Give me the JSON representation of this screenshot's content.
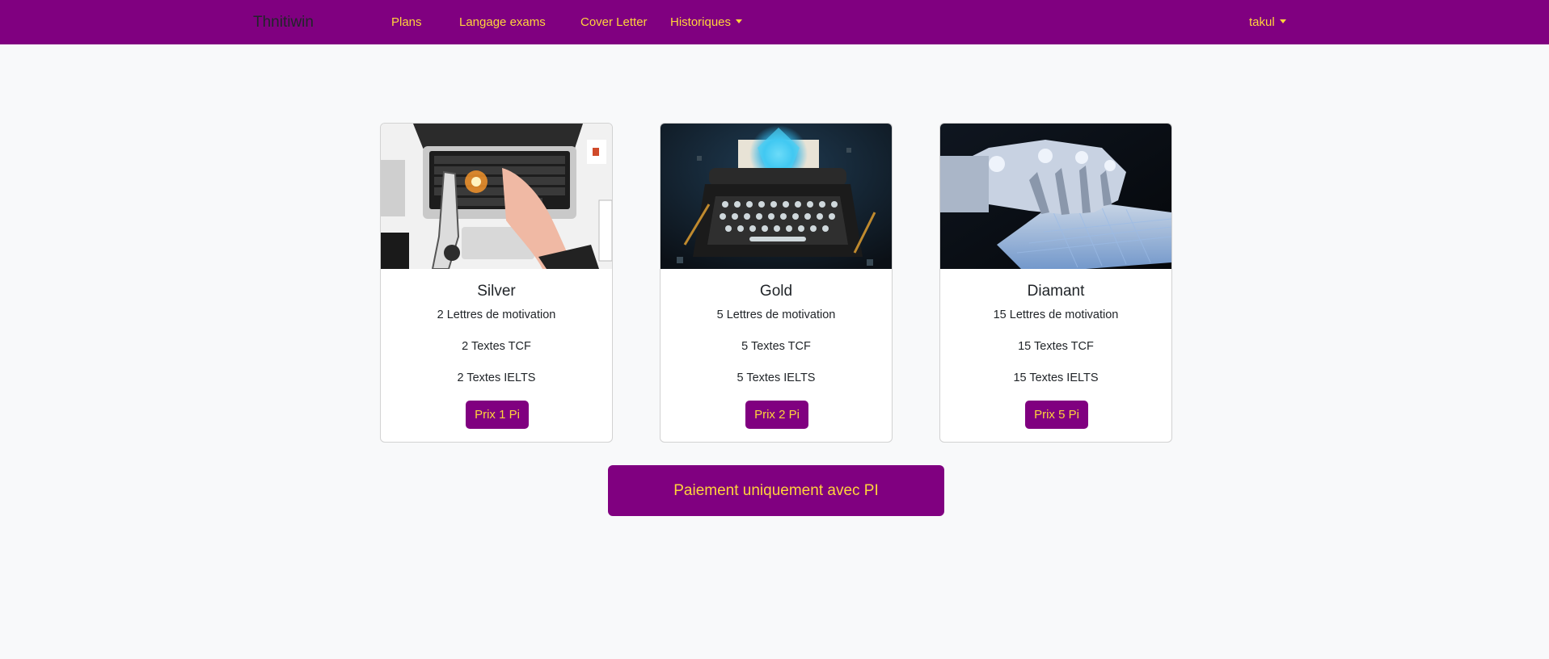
{
  "navbar": {
    "brand": "Thnitiwin",
    "links": [
      "Plans",
      "Langage exams",
      "Cover Letter"
    ],
    "history_dropdown": "Historiques",
    "user_dropdown": "takul",
    "colors": {
      "background": "#800080",
      "link": "#ffd43b"
    }
  },
  "plans": [
    {
      "title": "Silver",
      "lines": [
        "2 Lettres de motivation",
        "2 Textes TCF",
        "2 Textes IELTS"
      ],
      "price_label": "Prix 1 Pi"
    },
    {
      "title": "Gold",
      "lines": [
        "5 Lettres de motivation",
        "5 Textes TCF",
        "5 Textes IELTS"
      ],
      "price_label": "Prix 2 Pi"
    },
    {
      "title": "Diamant",
      "lines": [
        "15 Lettres de motivation",
        "15 Textes TCF",
        "15 Textes IELTS"
      ],
      "price_label": "Prix 5 Pi"
    }
  ],
  "payment_button": "Paiement uniquement avec PI",
  "colors": {
    "accent": "#800080",
    "accent_text": "#ffd43b",
    "page_background": "#f8f9fa"
  }
}
